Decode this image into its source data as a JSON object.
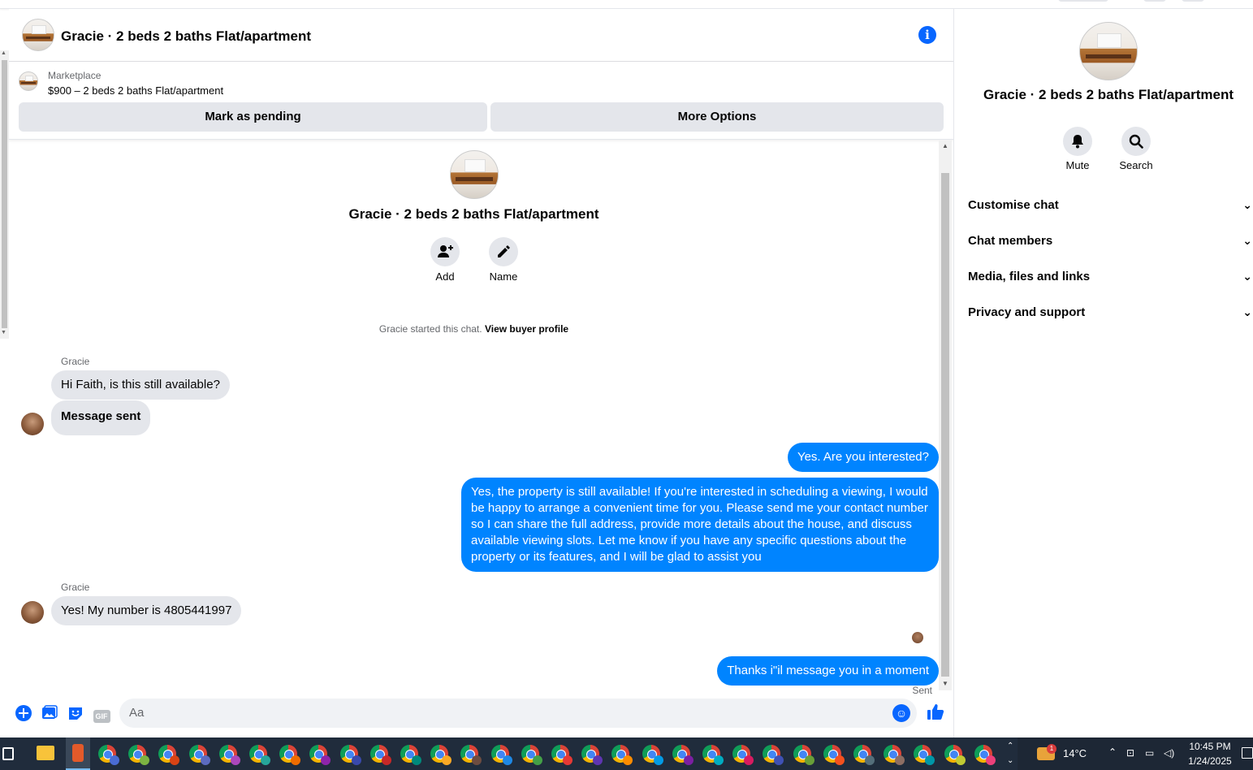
{
  "header": {
    "title": "Gracie · 2 beds 2 baths Flat/apartment"
  },
  "marketplace": {
    "label": "Marketplace",
    "listing": "$900 – 2 beds 2 baths Flat/apartment",
    "pending_label": "Mark as pending",
    "options_label": "More Options"
  },
  "intro": {
    "title": "Gracie · 2 beds 2 baths Flat/apartment",
    "add_label": "Add",
    "name_label": "Name",
    "started_text": "Gracie started this chat.",
    "view_profile": "View buyer profile"
  },
  "messages": {
    "sender1": "Gracie",
    "m1": "Hi Faith, is this still available?",
    "m2": "Message sent",
    "m3": "Yes. Are you interested?",
    "m4": "Yes, the property is still available! If you're interested in scheduling a viewing, I would be happy to arrange a convenient time for you. Please send me your contact number so I can share the full address, provide more details about the house, and discuss available viewing slots. Let me know if you have any specific questions about the property or its features, and I will be glad to assist you",
    "sender2": "Gracie",
    "m5": "Yes! My number is 4805441997",
    "m6": "Thanks i\"il message you in a moment",
    "status": "Sent"
  },
  "composer": {
    "placeholder": "Aa",
    "gif_label": "GIF"
  },
  "right_panel": {
    "title": "Gracie · 2 beds 2 baths Flat/apartment",
    "mute_label": "Mute",
    "search_label": "Search",
    "sections": [
      "Customise chat",
      "Chat members",
      "Media, files and links",
      "Privacy and support"
    ]
  },
  "taskbar": {
    "weather_badge": "1",
    "temperature": "14°C",
    "time": "10:45 PM",
    "date": "1/24/2025"
  },
  "colors": {
    "accent": "#0866ff",
    "outgoing_bubble": "#0084ff",
    "incoming_bubble": "#e4e6eb",
    "taskbar": "#202c3c"
  },
  "icons": {
    "info": "info-icon",
    "add_person": "add-person-icon",
    "edit": "pencil-icon",
    "mute": "bell-icon",
    "search": "search-icon",
    "chevron": "chevron-down-icon",
    "like": "thumbs-up-icon"
  }
}
